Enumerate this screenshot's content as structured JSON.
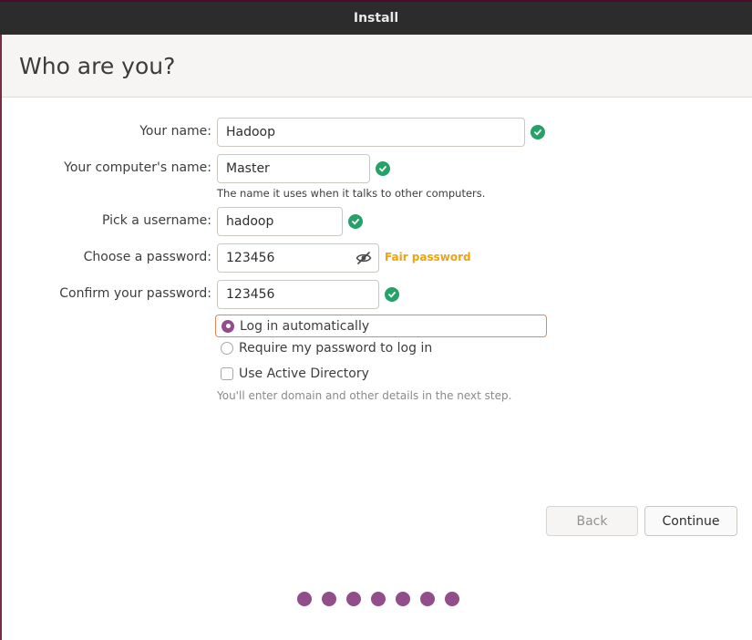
{
  "window": {
    "title": "Install"
  },
  "page": {
    "title": "Who are you?"
  },
  "form": {
    "name": {
      "label": "Your name:",
      "value": "Hadoop"
    },
    "computer": {
      "label": "Your computer's name:",
      "value": "Master",
      "hint": "The name it uses when it talks to other computers."
    },
    "username": {
      "label": "Pick a username:",
      "value": "hadoop"
    },
    "password": {
      "label": "Choose a password:",
      "value": "123456",
      "strength": "Fair password"
    },
    "confirm": {
      "label": "Confirm your password:",
      "value": "123456"
    }
  },
  "login_options": {
    "auto": {
      "label": "Log in automatically",
      "selected": true
    },
    "require": {
      "label": "Require my password to log in",
      "selected": false
    }
  },
  "active_directory": {
    "label": "Use Active Directory",
    "checked": false,
    "hint": "You'll enter domain and other details in the next step."
  },
  "buttons": {
    "back": "Back",
    "continue": "Continue"
  },
  "progress": {
    "steps_total": 7,
    "steps_shown": 7
  },
  "colors": {
    "accent": "#924d8b",
    "ok": "#26a269",
    "warning": "#f0a30a",
    "focus": "#e9835e"
  }
}
